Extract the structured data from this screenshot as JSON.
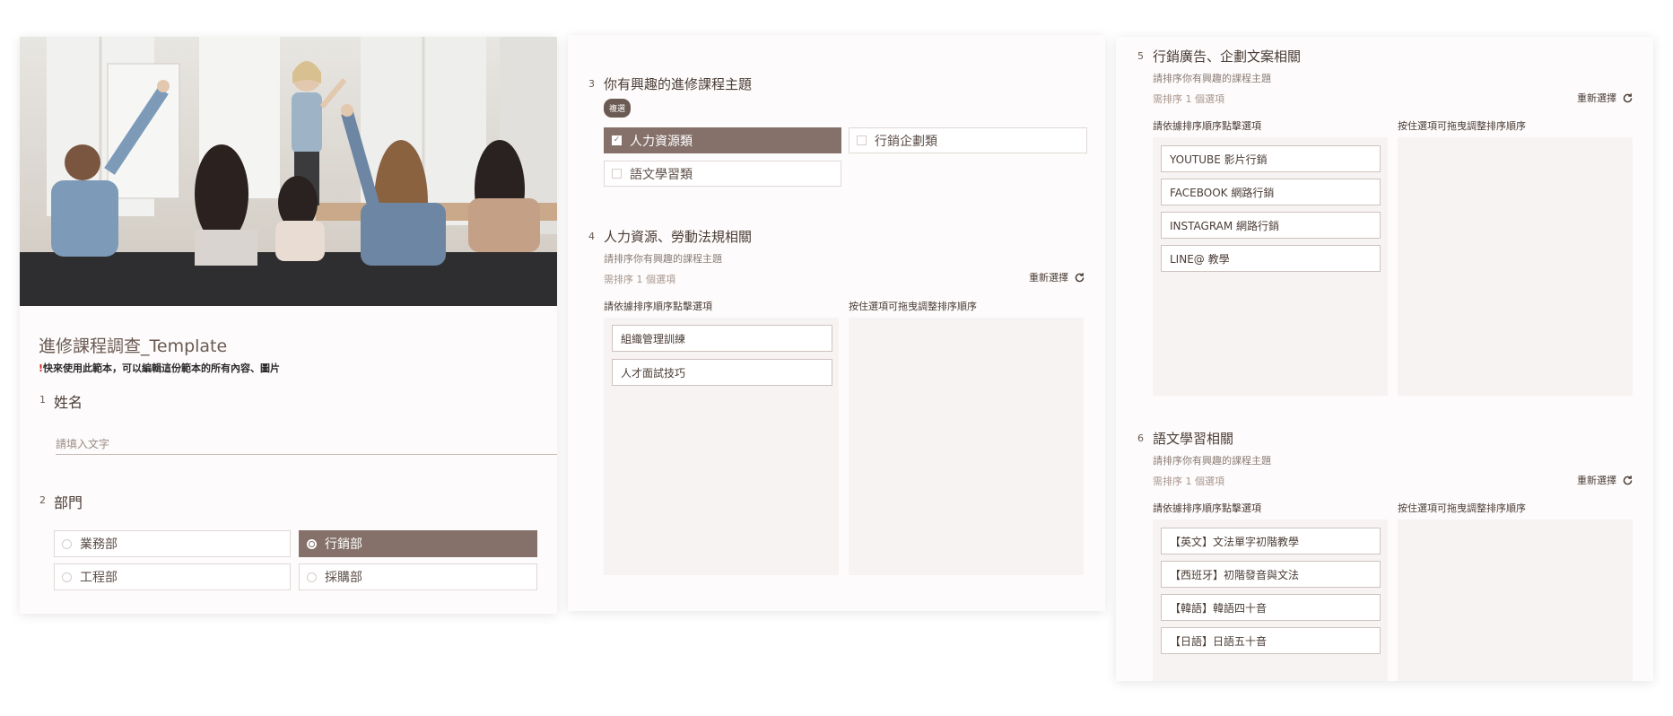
{
  "form": {
    "title": "進修課程調查_Template",
    "note_mark": "!",
    "note": "快來使用此範本，可以編輯這份範本的所有內容、圖片"
  },
  "q1": {
    "num": "1",
    "label": "姓名",
    "placeholder": "請填入文字"
  },
  "q2": {
    "num": "2",
    "label": "部門",
    "options": [
      "業務部",
      "行銷部",
      "工程部",
      "採購部"
    ],
    "selected": "行銷部"
  },
  "q3": {
    "num": "3",
    "label": "你有興趣的進修課程主題",
    "badge": "複選",
    "options": [
      "人力資源類",
      "行銷企劃類",
      "語文學習類"
    ],
    "selected": [
      "人力資源類"
    ]
  },
  "q4": {
    "num": "4",
    "label": "人力資源、勞動法規相關",
    "desc": "請排序你有興趣的課程主題",
    "hint": "需排序 1 個選項",
    "reset": "重新選擇",
    "left_label": "請依據排序順序點擊選項",
    "right_label": "按住選項可拖曳調整排序順序",
    "items": [
      "組織管理訓練",
      "人才面試技巧"
    ]
  },
  "q5": {
    "num": "5",
    "label": "行銷廣告、企劃文案相關",
    "desc": "請排序你有興趣的課程主題",
    "hint": "需排序 1 個選項",
    "reset": "重新選擇",
    "left_label": "請依據排序順序點擊選項",
    "right_label": "按住選項可拖曳調整排序順序",
    "items": [
      "YOUTUBE 影片行銷",
      "FACEBOOK 網路行銷",
      "INSTAGRAM 網路行銷",
      "LINE@ 教學"
    ]
  },
  "q6": {
    "num": "6",
    "label": "語文學習相關",
    "desc": "請排序你有興趣的課程主題",
    "hint": "需排序 1 個選項",
    "reset": "重新選擇",
    "left_label": "請依據排序順序點擊選項",
    "right_label": "按住選項可拖曳調整排序順序",
    "items": [
      "【英文】文法單字初階教學",
      "【西班牙】初階發音與文法",
      "【韓語】韓語四十音",
      "【日語】日語五十音"
    ]
  },
  "colors": {
    "accent": "#85716a",
    "badge": "#6b5a53",
    "pool": "#f7f3f2",
    "alert": "#d6281e"
  }
}
